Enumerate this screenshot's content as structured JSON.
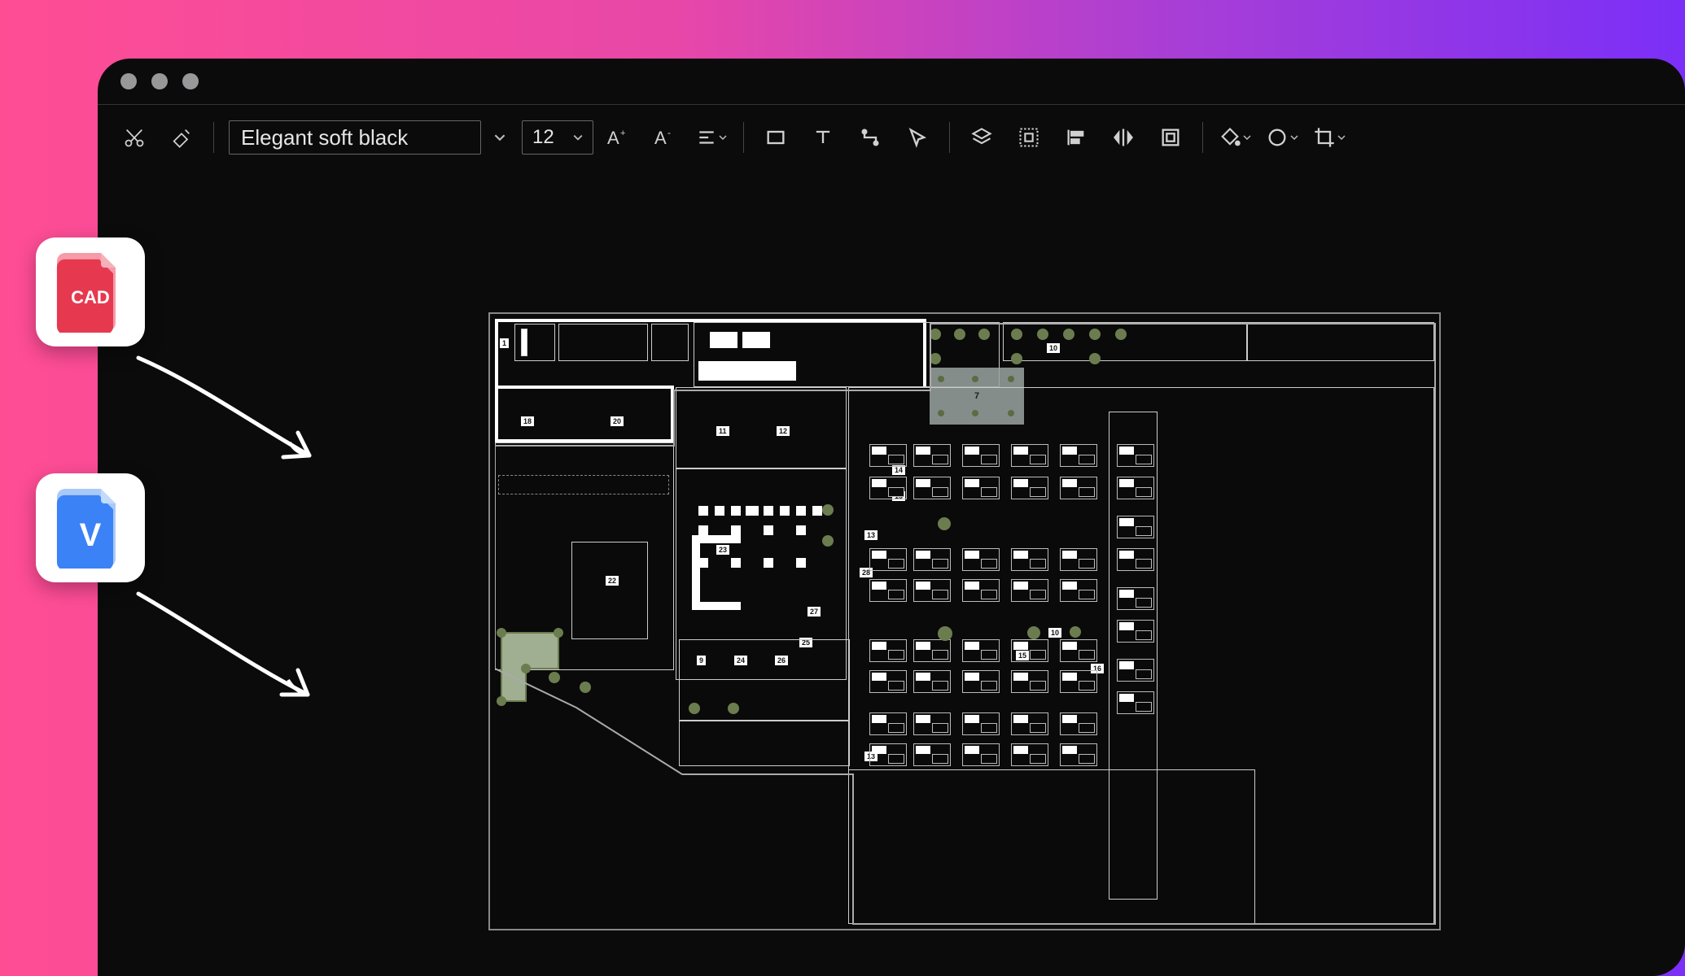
{
  "window": {
    "traffic_lights": 3
  },
  "toolbar": {
    "cut_label": "Cut",
    "format_painter_label": "Format Painter",
    "font_name": "Elegant soft black",
    "font_size": "12",
    "font_grow_label": "A+",
    "font_shrink_label": "A-",
    "align_label": "Align",
    "rect_label": "Rectangle",
    "text_label": "Text",
    "connector_label": "Connector",
    "pointer_label": "Pointer",
    "layers_label": "Layers",
    "group_label": "Group",
    "align_left_label": "Align Left",
    "flip_label": "Flip",
    "page_fit_label": "Fit Page",
    "fill_label": "Fill",
    "shadow_label": "Shadow",
    "crop_label": "Crop"
  },
  "file_cards": {
    "cad": {
      "badge": "CAD"
    },
    "visio": {
      "badge": "V"
    }
  },
  "floorplan": {
    "selected_label": "7",
    "room_labels": [
      "1",
      "18",
      "20",
      "11",
      "12",
      "14",
      "15",
      "13",
      "10",
      "22",
      "23",
      "10",
      "28",
      "27",
      "9",
      "24",
      "26",
      "25",
      "13",
      "16",
      "15",
      "10"
    ],
    "colors": {
      "tree": "#6b7d4f",
      "wall": "#ffffff",
      "bg": "#0a0a0a",
      "selection": "#9aa5a0"
    }
  }
}
